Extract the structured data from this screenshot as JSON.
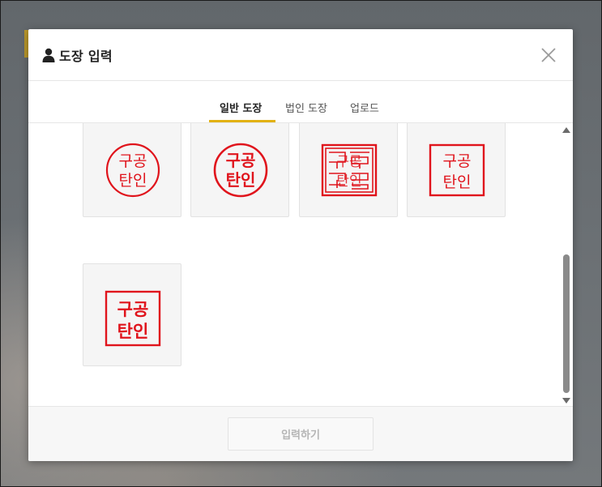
{
  "dialog": {
    "title": "도장 입력",
    "close_icon": "close-icon",
    "user_icon": "person-icon"
  },
  "tabs": [
    {
      "label": "일반 도장",
      "active": true
    },
    {
      "label": "법인 도장",
      "active": false
    },
    {
      "label": "업로드",
      "active": false
    }
  ],
  "stamps": [
    {
      "shape": "circle",
      "style": "regular",
      "line1": "구공",
      "line2": "탄인"
    },
    {
      "shape": "circle",
      "style": "bold",
      "line1": "구공",
      "line2": "탄인"
    },
    {
      "shape": "square",
      "style": "seal-script",
      "line1": "구공",
      "line2": "탄인"
    },
    {
      "shape": "square",
      "style": "regular",
      "line1": "구공",
      "line2": "탄인"
    },
    {
      "shape": "square",
      "style": "bold",
      "line1": "구공",
      "line2": "탄인"
    }
  ],
  "footer": {
    "submit_label": "입력하기",
    "submit_enabled": false
  },
  "colors": {
    "stamp_red": "#e0141c",
    "tab_accent": "#e2b214"
  },
  "scroll": {
    "position_fraction": 0.55
  }
}
